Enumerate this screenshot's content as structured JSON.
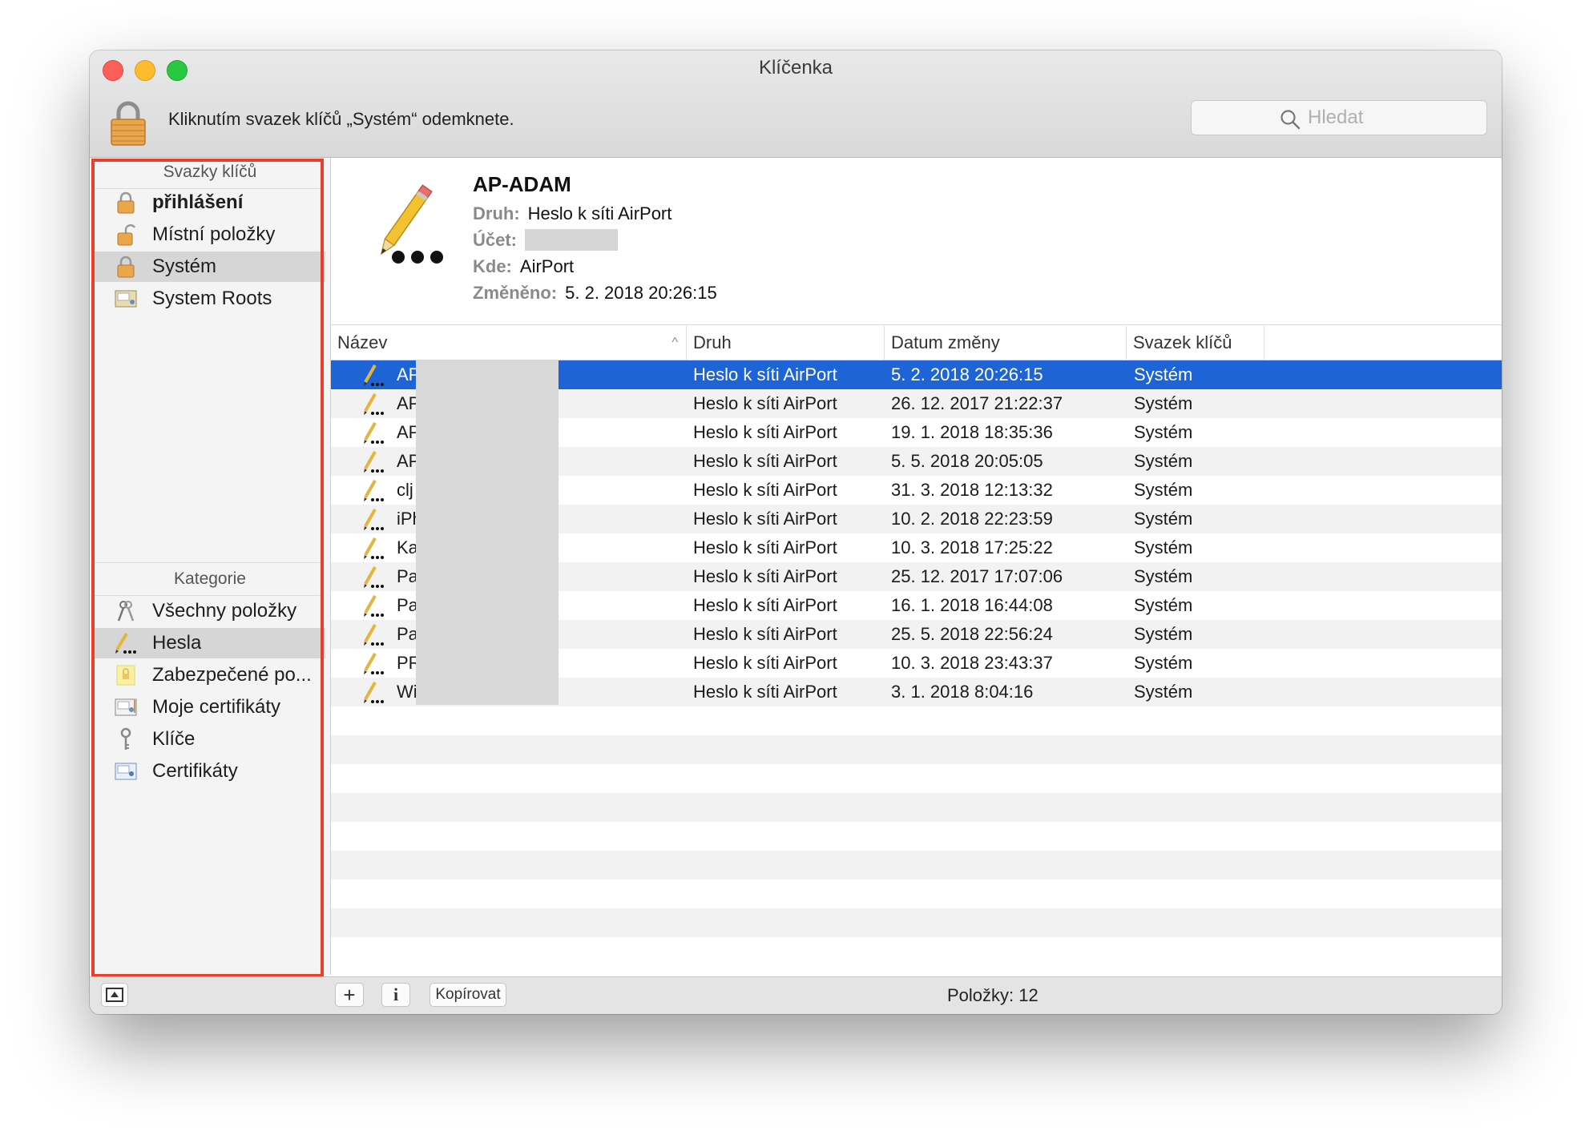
{
  "window": {
    "title": "Klíčenka"
  },
  "toolbar": {
    "lock_message": "Kliknutím svazek klíčů „Systém“ odemknete.",
    "search_placeholder": "Hledat"
  },
  "sidebar": {
    "keychains_title": "Svazky klíčů",
    "keychains": [
      {
        "label": "přihlášení",
        "icon": "lock-closed-icon",
        "bold": true
      },
      {
        "label": "Místní položky",
        "icon": "lock-open-icon"
      },
      {
        "label": "Systém",
        "icon": "lock-closed-icon",
        "selected": true
      },
      {
        "label": "System Roots",
        "icon": "certificate-folder-icon"
      }
    ],
    "categories_title": "Kategorie",
    "categories": [
      {
        "label": "Všechny položky",
        "icon": "all-items-icon"
      },
      {
        "label": "Hesla",
        "icon": "password-icon",
        "selected": true
      },
      {
        "label": "Zabezpečené po...",
        "icon": "secure-note-icon"
      },
      {
        "label": "Moje certifikáty",
        "icon": "my-certificate-icon"
      },
      {
        "label": "Klíče",
        "icon": "key-icon"
      },
      {
        "label": "Certifikáty",
        "icon": "certificate-icon"
      }
    ]
  },
  "detail": {
    "name": "AP-ADAM",
    "kind_label": "Druh:",
    "kind_value": "Heslo k síti AirPort",
    "account_label": "Účet:",
    "where_label": "Kde:",
    "where_value": "AirPort",
    "modified_label": "Změněno:",
    "modified_value": "5. 2. 2018 20:26:15"
  },
  "table": {
    "columns": [
      "Název",
      "Druh",
      "Datum změny",
      "Svazek klíčů"
    ],
    "rows": [
      {
        "name": "AP",
        "kind": "Heslo k síti AirPort",
        "date": "5. 2. 2018 20:26:15",
        "keychain": "Systém",
        "selected": true
      },
      {
        "name": "AP",
        "kind": "Heslo k síti AirPort",
        "date": "26. 12. 2017 21:22:37",
        "keychain": "Systém"
      },
      {
        "name": "AP",
        "kind": "Heslo k síti AirPort",
        "date": "19. 1. 2018 18:35:36",
        "keychain": "Systém"
      },
      {
        "name": "AP",
        "kind": "Heslo k síti AirPort",
        "date": "5. 5. 2018 20:05:05",
        "keychain": "Systém"
      },
      {
        "name": "clj",
        "kind": "Heslo k síti AirPort",
        "date": "31. 3. 2018 12:13:32",
        "keychain": "Systém"
      },
      {
        "name": "iPh",
        "kind": "Heslo k síti AirPort",
        "date": "10. 2. 2018 22:23:59",
        "keychain": "Systém"
      },
      {
        "name": "Ka",
        "kind": "Heslo k síti AirPort",
        "date": "10. 3. 2018 17:25:22",
        "keychain": "Systém"
      },
      {
        "name": "Pa",
        "kind": "Heslo k síti AirPort",
        "date": "25. 12. 2017 17:07:06",
        "keychain": "Systém"
      },
      {
        "name": "Pa",
        "kind": "Heslo k síti AirPort",
        "date": "16. 1. 2018 16:44:08",
        "keychain": "Systém"
      },
      {
        "name": "Pa",
        "kind": "Heslo k síti AirPort",
        "date": "25. 5. 2018 22:56:24",
        "keychain": "Systém"
      },
      {
        "name": "PR",
        "kind": "Heslo k síti AirPort",
        "date": "10. 3. 2018 23:43:37",
        "keychain": "Systém"
      },
      {
        "name": "Wi",
        "kind": "Heslo k síti AirPort",
        "date": "3. 1. 2018 8:04:16",
        "keychain": "Systém"
      }
    ]
  },
  "statusbar": {
    "add_label": "+",
    "info_label": "i",
    "copy_label": "Kopírovat",
    "count": "Položky: 12"
  },
  "colors": {
    "selection": "#1e64d6",
    "highlight_border": "#e8402f",
    "lock_gold": "#e9a646"
  }
}
